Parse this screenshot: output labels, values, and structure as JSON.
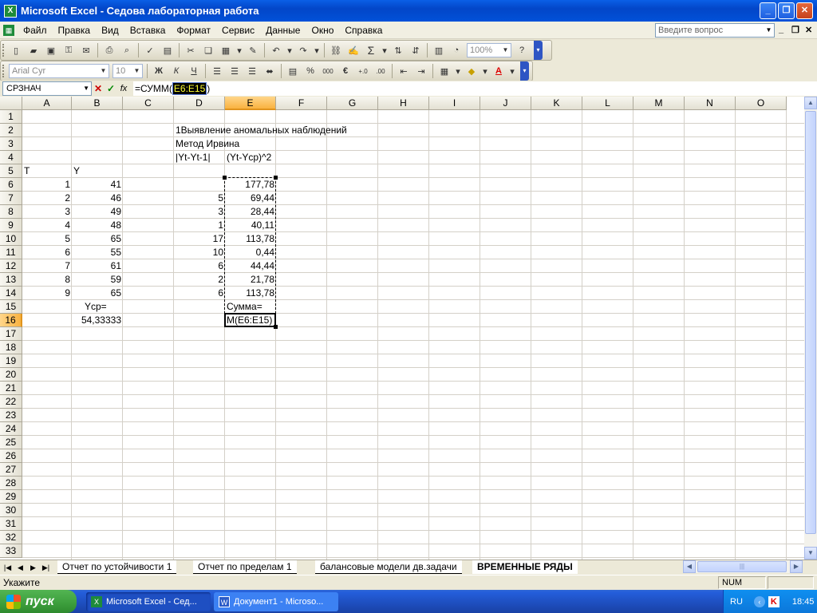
{
  "window": {
    "title": "Microsoft Excel - Седова лабораторная работа",
    "app_icon": "X"
  },
  "menu": [
    "Файл",
    "Правка",
    "Вид",
    "Вставка",
    "Формат",
    "Сервис",
    "Данные",
    "Окно",
    "Справка"
  ],
  "ask_placeholder": "Введите вопрос",
  "toolbar": {
    "zoom": "100%",
    "font_name": "Arial Cyr",
    "font_size": "10",
    "bold": "Ж",
    "italic": "К",
    "underline": "Ч",
    "sigma": "Σ",
    "euro": "€",
    "percent": "%",
    "thousands": "000"
  },
  "formula": {
    "name_box": "СРЗНАЧ",
    "prefix": "=СУММ(",
    "range": "E6:E15",
    "suffix": ")",
    "fx": "fx"
  },
  "columns": [
    "A",
    "B",
    "C",
    "D",
    "E",
    "F",
    "G",
    "H",
    "I",
    "J",
    "K",
    "L",
    "M",
    "N",
    "O"
  ],
  "rows": [
    "1",
    "2",
    "3",
    "4",
    "5",
    "6",
    "7",
    "8",
    "9",
    "10",
    "11",
    "12",
    "13",
    "14",
    "15",
    "16",
    "17",
    "18",
    "19",
    "20",
    "21",
    "22",
    "23",
    "24",
    "25",
    "26",
    "27",
    "28",
    "29",
    "30",
    "31",
    "32",
    "33"
  ],
  "cells": {
    "d2": "1Выявление аномальных наблюдений",
    "d3": "Метод Ирвина",
    "d4": "|Yt-Yt-1|",
    "e4": "(Yt-Ycp)^2",
    "a5": "T",
    "b5": "Y",
    "a": [
      "1",
      "2",
      "3",
      "4",
      "5",
      "6",
      "7",
      "8",
      "9"
    ],
    "b": [
      "41",
      "46",
      "49",
      "48",
      "65",
      "55",
      "61",
      "59",
      "65"
    ],
    "d": [
      "",
      "5",
      "3",
      "1",
      "17",
      "10",
      "6",
      "2",
      "6"
    ],
    "e": [
      "177,78",
      "69,44",
      "28,44",
      "40,11",
      "113,78",
      "0,44",
      "44,44",
      "21,78",
      "113,78"
    ],
    "b15": "Ycp=",
    "b16": "54,33333",
    "e15": "Сумма=",
    "e16": "М(E6:E15)"
  },
  "sheets": [
    "Отчет по устойчивости 1",
    "Отчет по пределам 1",
    "балансовые модели дв.задачи",
    "ВРЕМЕННЫЕ РЯДЫ"
  ],
  "status": {
    "mode": "Укажите",
    "num": "NUM"
  },
  "taskbar": {
    "start": "пуск",
    "items": [
      "Microsoft Excel - Сед...",
      "Документ1 - Microso..."
    ],
    "lang": "RU",
    "time": "18:45"
  }
}
